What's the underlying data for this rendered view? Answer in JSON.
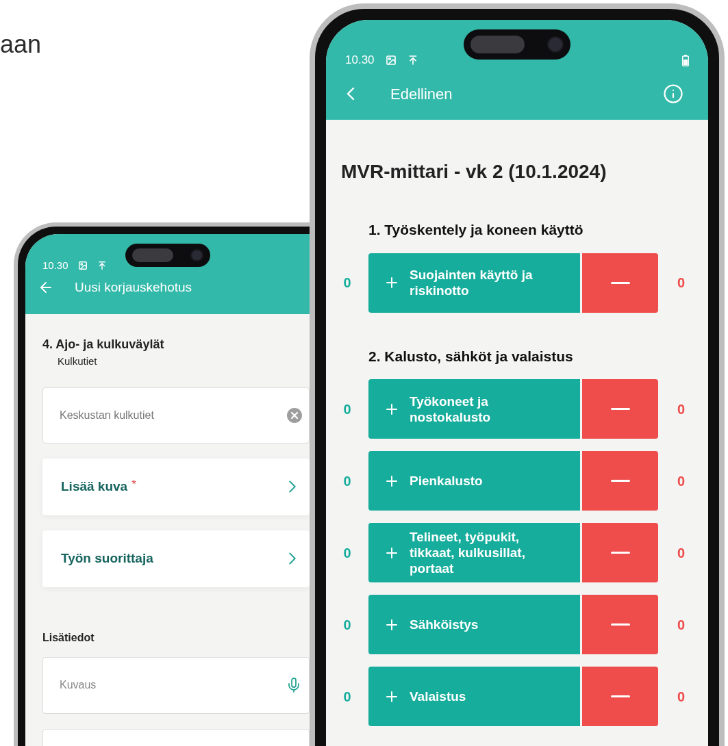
{
  "caption": "aan",
  "back_phone": {
    "status_time": "10.30",
    "title": "Uusi korjauskehotus",
    "section": {
      "title": "4. Ajo- ja kulkuväylät",
      "subtitle": "Kulkutiet"
    },
    "location_field": {
      "value": "Keskustan kulkutiet"
    },
    "links": [
      {
        "label": "Lisää kuva",
        "required_mark": "*"
      },
      {
        "label": "Työn suorittaja"
      }
    ],
    "details_heading": "Lisätiedot",
    "description_field": {
      "placeholder": "Kuvaus"
    }
  },
  "front_phone": {
    "status_time": "10.30",
    "back_label": "Edellinen",
    "title": "MVR-mittari - vk 2 (10.1.2024)",
    "groups": [
      {
        "title": "1. Työskentely ja koneen käyttö",
        "items": [
          {
            "label": "Suojainten käyttö ja riskinotto",
            "plus_count": "0",
            "minus_count": "0"
          }
        ]
      },
      {
        "title": "2. Kalusto, sähköt ja valaistus",
        "items": [
          {
            "label": "Työkoneet ja nostokalusto",
            "plus_count": "0",
            "minus_count": "0"
          },
          {
            "label": "Pienkalusto",
            "plus_count": "0",
            "minus_count": "0"
          },
          {
            "label": "Telineet, työpukit, tikkaat, kulkusillat, portaat",
            "plus_count": "0",
            "minus_count": "0"
          },
          {
            "label": "Sähköistys",
            "plus_count": "0",
            "minus_count": "0"
          },
          {
            "label": "Valaistus",
            "plus_count": "0",
            "minus_count": "0"
          }
        ]
      }
    ]
  }
}
